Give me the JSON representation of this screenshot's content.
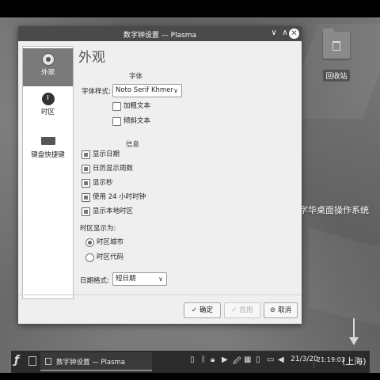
{
  "desktop": {
    "trash_label": "回收站",
    "brand_text": "字华桌面操作系统"
  },
  "window": {
    "title": "数字钟设置 — Plasma",
    "controls": {
      "minimize_glyph": "∨",
      "maximize_glyph": "∧",
      "close_glyph": "✕"
    },
    "sidebar": {
      "items": [
        {
          "label": "外观",
          "icon": "appearance-icon",
          "selected": true
        },
        {
          "label": "时区",
          "icon": "clock-icon",
          "selected": false
        },
        {
          "label": "键盘快捷键",
          "icon": "keyboard-icon",
          "selected": false
        }
      ]
    },
    "page_title": "外观",
    "font_section": {
      "heading": "字体",
      "style_label": "字体样式:",
      "font_value": "Noto Serif Khmer",
      "bold_label": "加粗文本",
      "bold_checked": false,
      "italic_label": "倾斜文本",
      "italic_checked": false
    },
    "info_section": {
      "heading": "信息",
      "options": [
        {
          "label": "显示日期",
          "checked": true
        },
        {
          "label": "日历显示周数",
          "checked": true
        },
        {
          "label": "显示秒",
          "checked": true
        },
        {
          "label": "使用 24 小时时钟",
          "checked": true
        },
        {
          "label": "显示本地时区",
          "checked": true
        }
      ],
      "timezone_display_label": "时区显示为:",
      "timezone_options": [
        {
          "label": "时区城市",
          "selected": true
        },
        {
          "label": "时区代码",
          "selected": false
        }
      ],
      "date_format_label": "日期格式:",
      "date_format_value": "短日期"
    },
    "buttons": {
      "ok": "确定",
      "apply": "应用",
      "cancel": "取消"
    }
  },
  "taskbar": {
    "task_label": "数字钟设置 — Plasma",
    "date": "21/3/20",
    "time": "21:19:03",
    "timezone": "(上海)"
  }
}
